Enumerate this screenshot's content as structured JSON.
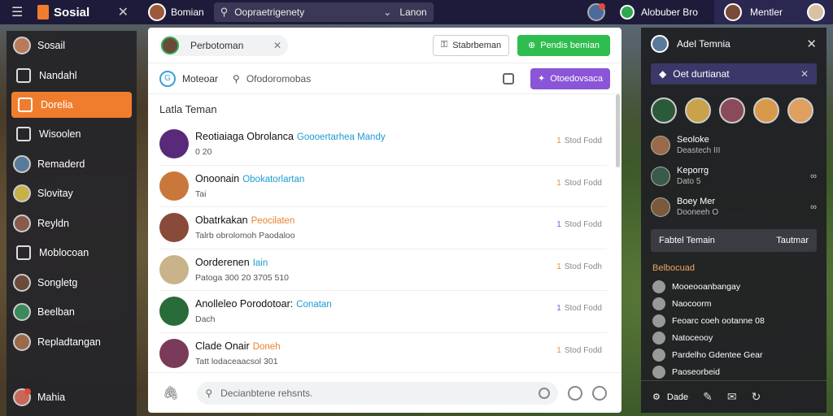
{
  "topbar": {
    "brand": "Sosial",
    "user_name": "Bomian",
    "search_text": "Oopraetrigenety",
    "search_right": "Lanon",
    "group_name": "Alobuber Bro",
    "profile_name": "Mentler"
  },
  "sidebar": {
    "items": [
      {
        "label": "Sosail"
      },
      {
        "label": "Nandahl"
      },
      {
        "label": "Dorelia"
      },
      {
        "label": "Wisoolen"
      },
      {
        "label": "Remaderd"
      },
      {
        "label": "Slovitay"
      },
      {
        "label": "Reyldn"
      },
      {
        "label": "Moblocoan"
      },
      {
        "label": "Songletg"
      },
      {
        "label": "Beelban"
      },
      {
        "label": "Repladtangan"
      }
    ],
    "bottom_label": "Mahia"
  },
  "main": {
    "chip_label": "Perbotoman",
    "btn_outline": "Stabrbeman",
    "btn_green": "Pendis bemian",
    "filter_label": "Moteoar",
    "filter_search": "Ofodoromobas",
    "btn_purple": "Otoedovsaca",
    "list_title": "Latla Teman",
    "rows": [
      {
        "name": "Reotiaiaga Obrolanca",
        "accent": "Goooertarhea Mandy",
        "sub": "0 20",
        "num": "1",
        "meta": "Stod Fodd",
        "color": "#5a2a7a"
      },
      {
        "name": "Onoonain",
        "accent": "Obokatorlartan",
        "sub": "Tai",
        "num": "1",
        "meta": "Stod Fodd",
        "color": "#c9773b"
      },
      {
        "name": "Obatrkakan",
        "accent": "Peocilaten",
        "sub": "Talrb obrolomoh Paodaloo",
        "num": "1",
        "meta": "Stod Fodd",
        "color": "#8a4a3a"
      },
      {
        "name": "Oorderenen",
        "accent": "Iain",
        "sub": "Patoga 300 20 3705 510",
        "num": "1",
        "meta": "Stod Fodh",
        "color": "#c8b38a"
      },
      {
        "name": "Anolleleo Porodotoar:",
        "accent": "Conatan",
        "sub": "Dach",
        "num": "1",
        "meta": "Stod Fodd",
        "color": "#2a6b3a"
      },
      {
        "name": "Clade Onair",
        "accent": "Doneh",
        "sub": "Tatt lodaceaacsol 301",
        "num": "1",
        "meta": "Stod Fodd",
        "color": "#7a3a5a"
      }
    ],
    "composer_placeholder": "Decianbtene rehsnts."
  },
  "rpanel": {
    "title": "Adel Temnia",
    "bar_label": "Oet durtianat",
    "users": [
      {
        "name": "Seoloke",
        "sub": "Deastech III"
      },
      {
        "name": "Keporrg",
        "sub": "Dato 5"
      },
      {
        "name": "Boey Mer",
        "sub": "Dooneeh O"
      }
    ],
    "card_left": "Fabtel Temain",
    "card_right": "Tautmar",
    "section": "Belbocuad",
    "lines": [
      "Mooeooanbangay",
      "Naocoorm",
      "Feoarc coeh ootanne 08",
      "Natoceooy",
      "Pardelho Gdentee Gear",
      "Paoseorbeid"
    ],
    "foot_label": "Dade"
  }
}
